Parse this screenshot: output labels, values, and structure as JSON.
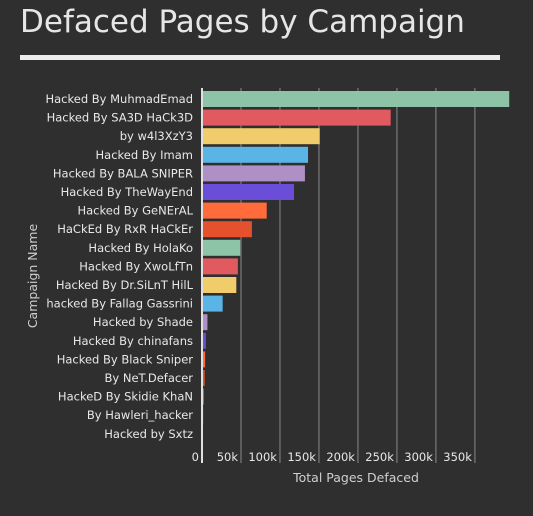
{
  "title": "Defaced Pages by Campaign",
  "chart_data": {
    "type": "bar",
    "orientation": "horizontal",
    "title": "Defaced Pages by Campaign",
    "xlabel": "Total Pages Defaced",
    "ylabel": "Campaign Name",
    "xlim": [
      0,
      395000
    ],
    "xticks": [
      0,
      50000,
      100000,
      150000,
      200000,
      250000,
      300000,
      350000
    ],
    "xtick_labels": [
      "0",
      "50k",
      "100k",
      "150k",
      "200k",
      "250k",
      "300k",
      "350k"
    ],
    "grid": true,
    "categories": [
      "Hacked By MuhmadEmad",
      "Hacked By SA3D HaCk3D",
      "by w4l3XzY3",
      "Hacked By Imam",
      "Hacked By BALA SNIPER",
      "Hacked By TheWayEnd",
      "Hacked By GeNErAL",
      "HaCkEd By RxR HaCkEr",
      "Hacked By HolaKo",
      "Hacked By XwoLfTn",
      "Hacked By Dr.SiLnT HilL",
      "hacked By Fallag Gassrini",
      "Hacked by Shade",
      "Hacked By chinafans",
      "Hacked By Black Sniper",
      "By NeT.Defacer",
      "HackeD By Skidie KhaN",
      "By Hawleri_hacker",
      "Hacked by Sxtz"
    ],
    "values": [
      394000,
      242000,
      151000,
      136000,
      132000,
      118000,
      83000,
      64000,
      49000,
      46000,
      44000,
      26500,
      7000,
      5000,
      4000,
      3500,
      2000,
      1500,
      1000
    ],
    "colors": [
      "#8dc3a7",
      "#e05a5f",
      "#f1cc6b",
      "#5ab4e5",
      "#ae8fc6",
      "#6a4ed8",
      "#ff6b3a",
      "#e5512c",
      "#8dc3a7",
      "#e05a5f",
      "#f1cc6b",
      "#5ab4e5",
      "#ae8fc6",
      "#6a4ed8",
      "#ff6b3a",
      "#e5512c",
      "#8dc3a7",
      "#e05a5f",
      "#f1cc6b"
    ]
  }
}
